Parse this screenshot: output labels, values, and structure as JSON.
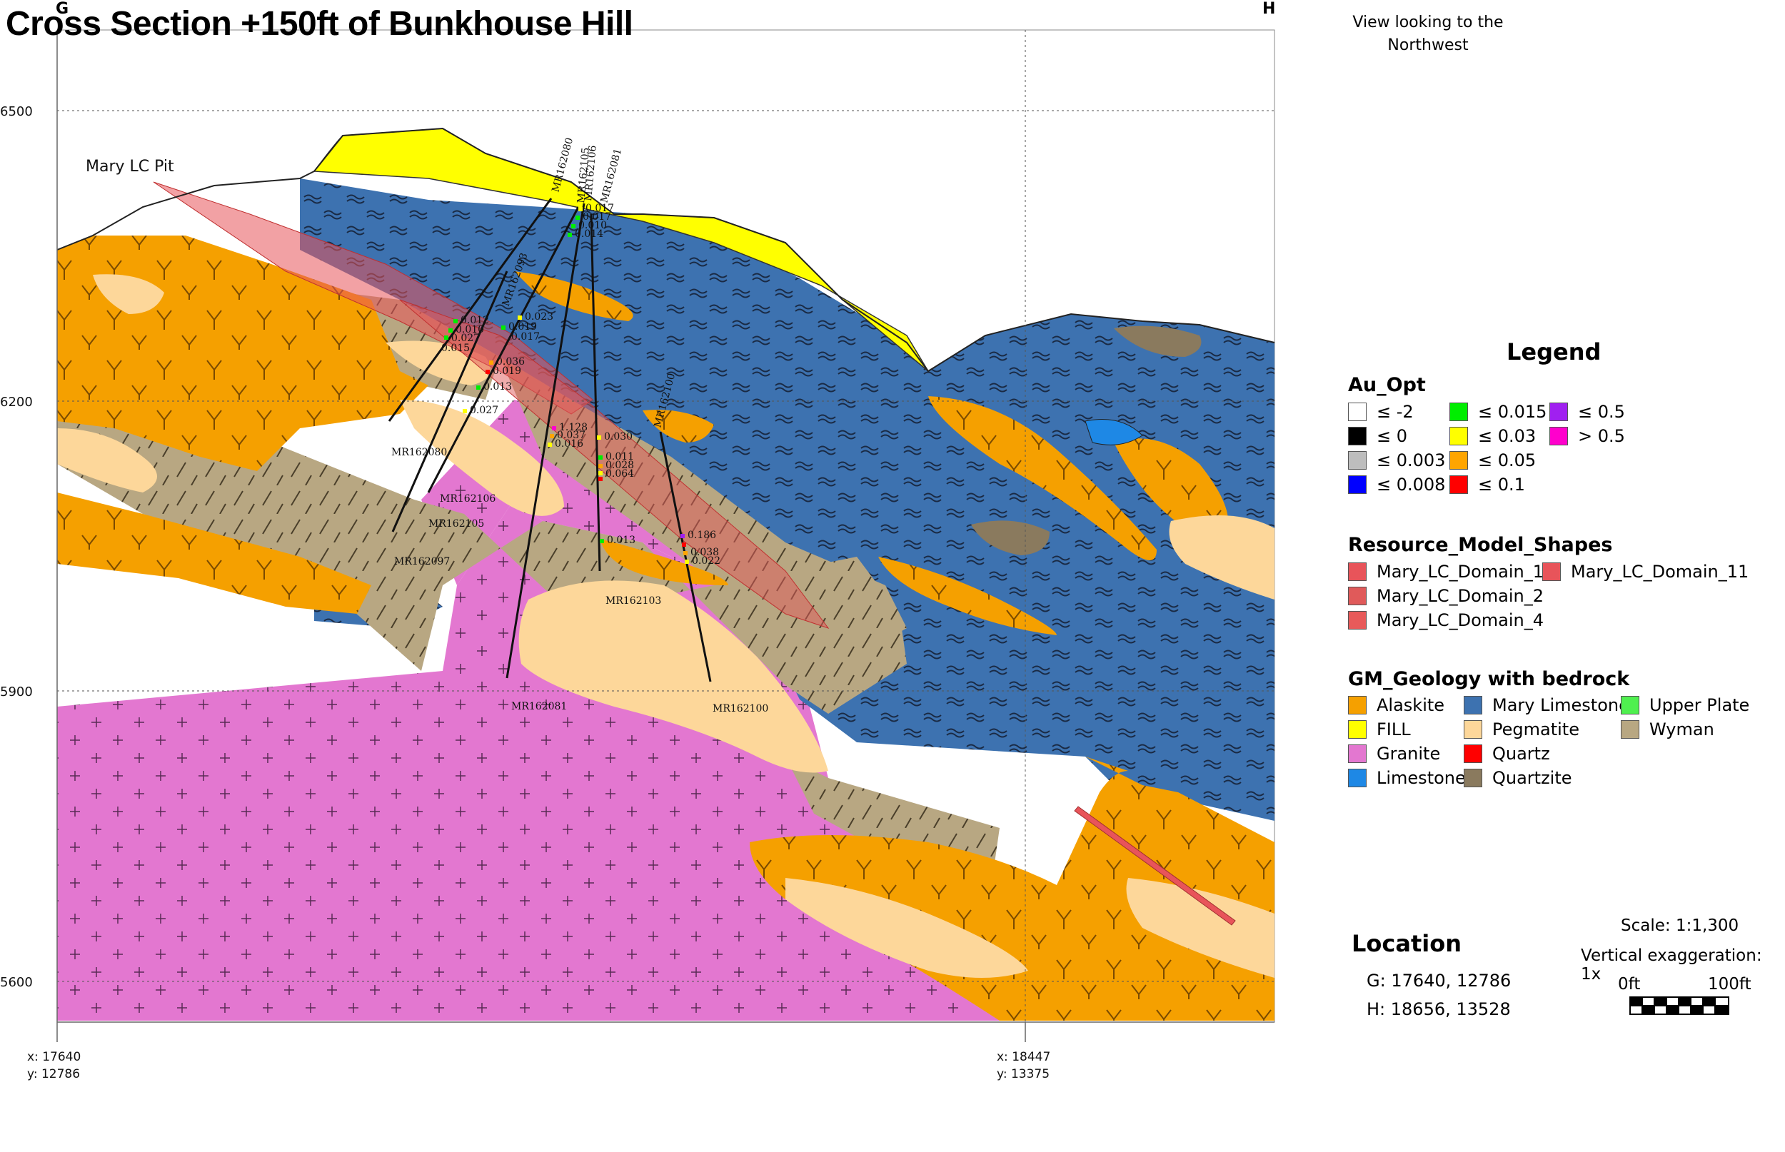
{
  "title": "Cross Section +150ft of Bunkhouse Hill",
  "corner_left": "G",
  "corner_right": "H",
  "view_note_line1": "View looking to the",
  "view_note_line2": "Northwest",
  "elevation_labels": [
    "6500",
    "6200",
    "5900",
    "5600"
  ],
  "pit_label": "Mary LC Pit",
  "bottom_coords": {
    "left_x": "x:  17640",
    "left_y": "y:  12786",
    "right_x": "x:  18447",
    "right_y": "y:  13375"
  },
  "drillholes": [
    {
      "id": "MR162080",
      "top_label": "MR162080",
      "bottom_label": "MR162080"
    },
    {
      "id": "MR162106",
      "top_label": "MR162106",
      "bottom_label": "MR162106"
    },
    {
      "id": "MR162105",
      "top_label": "MR162105",
      "bottom_label": "MR162105"
    },
    {
      "id": "MR162081",
      "top_label": "MR162081",
      "bottom_label": "MR162081"
    },
    {
      "id": "MR162097",
      "bottom_label": "MR162097"
    },
    {
      "id": "MR162103",
      "bottom_label": "MR162103"
    },
    {
      "id": "MR162100",
      "top_label": "MR162100",
      "bottom_label": "MR162100"
    },
    {
      "id": "MR162093",
      "top_label": "MR162093"
    }
  ],
  "assay_labels": [
    "0.017",
    "0.017",
    "0.010",
    "0.014",
    "0.012",
    "0.010",
    "0.027",
    "0.015",
    "0.023",
    "0.019",
    "0.017",
    "0.036",
    "0.019",
    "0.013",
    "0.027",
    "1.128",
    "0.037",
    "0.016",
    "0.030",
    "0.011",
    "0.028",
    "0.064",
    "0.013",
    "0.186",
    "0.038",
    "0.022"
  ],
  "legend": {
    "title": "Legend",
    "au_title": "Au_Opt",
    "au_items": [
      {
        "label": "≤ -2",
        "color": "#ffffff"
      },
      {
        "label": "≤ 0",
        "color": "#000000"
      },
      {
        "label": "≤ 0.003",
        "color": "#bdbdbd"
      },
      {
        "label": "≤ 0.008",
        "color": "#0000ff"
      },
      {
        "label": "≤ 0.015",
        "color": "#00ee00"
      },
      {
        "label": "≤ 0.03",
        "color": "#ffff00"
      },
      {
        "label": "≤ 0.05",
        "color": "#ffa500"
      },
      {
        "label": "≤ 0.1",
        "color": "#ff0000"
      },
      {
        "label": "≤ 0.5",
        "color": "#a020f0"
      },
      {
        "label": "> 0.5",
        "color": "#ff00cc"
      }
    ],
    "resource_title": "Resource_Model_Shapes",
    "resource_items": [
      {
        "label": "Mary_LC_Domain_1",
        "color": "#e8545a"
      },
      {
        "label": "Mary_LC_Domain_11",
        "color": "#e8545a"
      },
      {
        "label": "Mary_LC_Domain_2",
        "color": "#e05a5a"
      },
      {
        "label": "Mary_LC_Domain_4",
        "color": "#e85a5a"
      }
    ],
    "geology_title": "GM_Geology with bedrock",
    "geology_items": [
      {
        "label": "Alaskite",
        "color": "#f5a000"
      },
      {
        "label": "Mary Limestone",
        "color": "#3d72b0"
      },
      {
        "label": "Upper Plate",
        "color": "#4ff04f"
      },
      {
        "label": "FILL",
        "color": "#ffff00"
      },
      {
        "label": "Pegmatite",
        "color": "#fdd79a"
      },
      {
        "label": "Wyman",
        "color": "#b8a782"
      },
      {
        "label": "Granite",
        "color": "#e377d0"
      },
      {
        "label": "Quartz",
        "color": "#ff0000"
      },
      {
        "label": "Limestone",
        "color": "#1e88e5"
      },
      {
        "label": "Quartzite",
        "color": "#8a7a5e"
      }
    ]
  },
  "location": {
    "title": "Location",
    "g": "G:   17640, 12786",
    "h": "H:   18656, 13528"
  },
  "scale": {
    "text": "Scale:  1:1,300",
    "vertical": "Vertical exaggeration:  1x",
    "start": "0ft",
    "end": "100ft"
  }
}
